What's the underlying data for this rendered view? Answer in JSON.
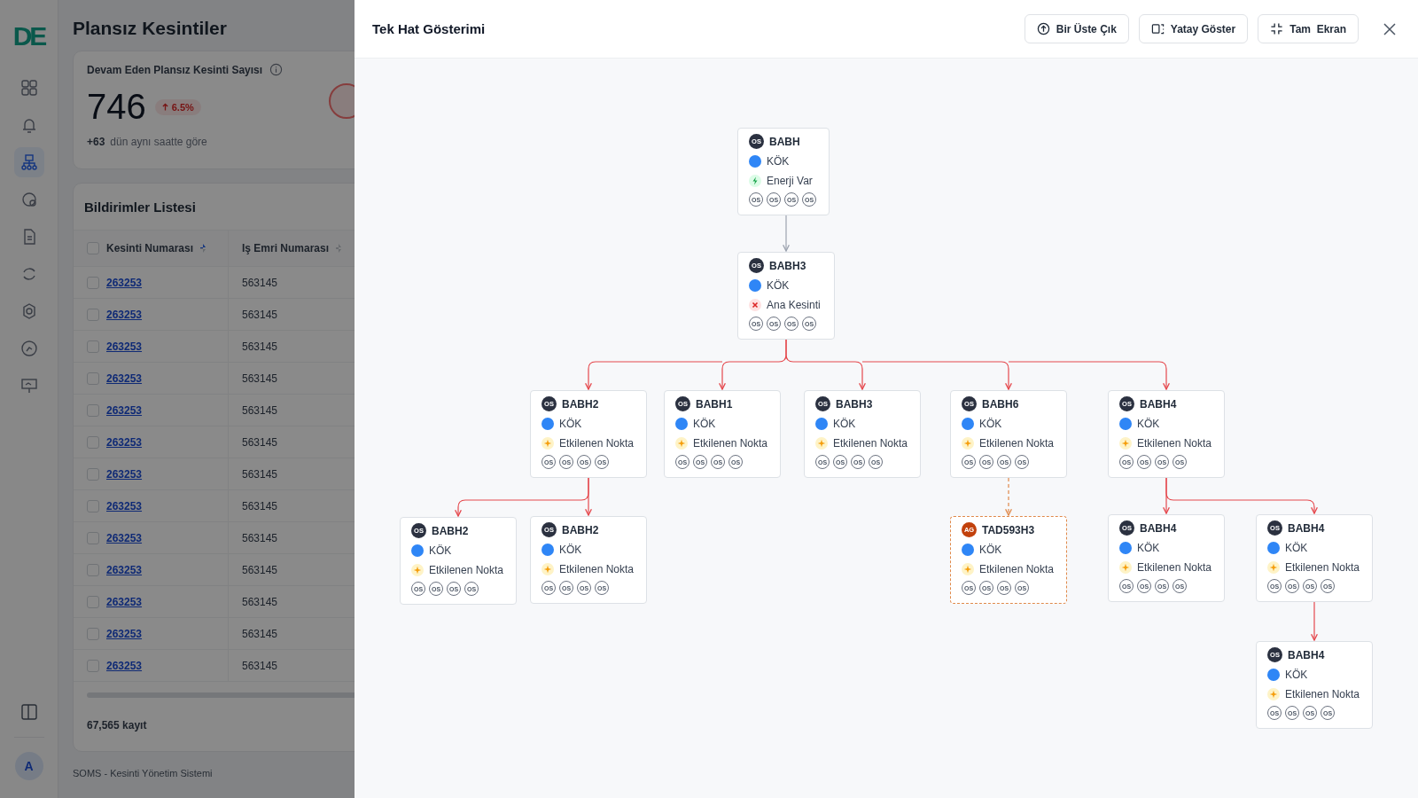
{
  "app": {
    "logo_text": "DE",
    "title": "Plansız Kesintiler",
    "sidebar": {
      "items": [
        {
          "selected": false
        },
        {
          "selected": false
        },
        {
          "selected": true
        },
        {
          "selected": false
        },
        {
          "selected": false
        },
        {
          "selected": false
        },
        {
          "selected": false
        },
        {
          "selected": false
        },
        {
          "selected": false
        }
      ],
      "avatar": "A"
    },
    "summary": {
      "label": "Devam Eden Plansız Kesinti Sayısı",
      "value": "746",
      "change": "6.5%",
      "delta": "+63",
      "delta_note": "dün aynı saatte göre"
    },
    "list": {
      "title": "Bildirimler Listesi",
      "header_checked": false,
      "columns": [
        "Kesinti Numarası",
        "Iş Emri Numarası"
      ],
      "rows": [
        {
          "checked": false,
          "cells": [
            "263253",
            "563145"
          ]
        },
        {
          "checked": false,
          "cells": [
            "263253",
            "563145"
          ]
        },
        {
          "checked": false,
          "cells": [
            "263253",
            "563145"
          ]
        },
        {
          "checked": false,
          "cells": [
            "263253",
            "563145"
          ]
        },
        {
          "checked": false,
          "cells": [
            "263253",
            "563145"
          ]
        },
        {
          "checked": false,
          "cells": [
            "263253",
            "563145"
          ]
        },
        {
          "checked": false,
          "cells": [
            "263253",
            "563145"
          ]
        },
        {
          "checked": false,
          "cells": [
            "263253",
            "563145"
          ]
        },
        {
          "checked": false,
          "cells": [
            "263253",
            "563145"
          ]
        },
        {
          "checked": false,
          "cells": [
            "263253",
            "563145"
          ]
        },
        {
          "checked": false,
          "cells": [
            "263253",
            "563145"
          ]
        },
        {
          "checked": false,
          "cells": [
            "263253",
            "563145"
          ]
        },
        {
          "checked": false,
          "cells": [
            "263253",
            "563145"
          ]
        }
      ],
      "count": "67,565 kayıt"
    },
    "footer": "SOMS - Kesinti Yönetim Sistemi"
  },
  "modal": {
    "title": "Tek Hat Gösterimi",
    "buttons": [
      {
        "kind": "up",
        "label": "Bir Üste Çık"
      },
      {
        "kind": "horizontal",
        "label": "Yatay Göster"
      },
      {
        "kind": "fullscreen",
        "label": "Tam  Ekran"
      }
    ],
    "root": {
      "name": "BABH",
      "badge": "OS",
      "color": "#2b3140",
      "type": "KÖK",
      "status": {
        "kind": "energized",
        "label": "Enerji Var"
      },
      "tags": [
        "OS",
        "OS",
        "OS",
        "OS"
      ],
      "dashed": false,
      "children": [
        {
          "name": "BABH3",
          "badge": "OS",
          "color": "#2b3140",
          "type": "KÖK",
          "status": {
            "kind": "main_outage",
            "label": "Ana Kesinti"
          },
          "tags": [
            "OS",
            "OS",
            "OS",
            "OS"
          ],
          "dashed": false,
          "children": [
            {
              "name": "BABH2",
              "badge": "OS",
              "color": "#2b3140",
              "type": "KÖK",
              "status": {
                "kind": "affected",
                "label": "Etkilenen Nokta"
              },
              "tags": [
                "OS",
                "OS",
                "OS",
                "OS"
              ],
              "dashed": false,
              "children": [
                {
                  "name": "BABH2",
                  "badge": "OS",
                  "color": "#2b3140",
                  "type": "KÖK",
                  "status": {
                    "kind": "affected",
                    "label": "Etkilenen Nokta"
                  },
                  "tags": [
                    "OS",
                    "OS",
                    "OS",
                    "OS"
                  ],
                  "dashed": false
                },
                {
                  "name": "BABH2",
                  "badge": "OS",
                  "color": "#2b3140",
                  "type": "KÖK",
                  "status": {
                    "kind": "affected",
                    "label": "Etkilenen Nokta"
                  },
                  "tags": [
                    "OS",
                    "OS",
                    "OS",
                    "OS"
                  ],
                  "dashed": false
                }
              ]
            },
            {
              "name": "BABH1",
              "badge": "OS",
              "color": "#2b3140",
              "type": "KÖK",
              "status": {
                "kind": "affected",
                "label": "Etkilenen Nokta"
              },
              "tags": [
                "OS",
                "OS",
                "OS",
                "OS"
              ],
              "dashed": false
            },
            {
              "name": "BABH3",
              "badge": "OS",
              "color": "#2b3140",
              "type": "KÖK",
              "status": {
                "kind": "affected",
                "label": "Etkilenen Nokta"
              },
              "tags": [
                "OS",
                "OS",
                "OS",
                "OS"
              ],
              "dashed": false
            },
            {
              "name": "BABH6",
              "badge": "OS",
              "color": "#2b3140",
              "type": "KÖK",
              "status": {
                "kind": "affected",
                "label": "Etkilenen Nokta"
              },
              "tags": [
                "OS",
                "OS",
                "OS",
                "OS"
              ],
              "dashed": false,
              "children": [
                {
                  "name": "TAD593H3",
                  "badge": "AG",
                  "color": "#c2410c",
                  "type": "KÖK",
                  "status": {
                    "kind": "affected",
                    "label": "Etkilenen Nokta"
                  },
                  "tags": [
                    "OS",
                    "OS",
                    "OS",
                    "OS"
                  ],
                  "dashed": true
                }
              ]
            },
            {
              "name": "BABH4",
              "badge": "OS",
              "color": "#2b3140",
              "type": "KÖK",
              "status": {
                "kind": "affected",
                "label": "Etkilenen Nokta"
              },
              "tags": [
                "OS",
                "OS",
                "OS",
                "OS"
              ],
              "dashed": false,
              "children": [
                {
                  "name": "BABH4",
                  "badge": "OS",
                  "color": "#2b3140",
                  "type": "KÖK",
                  "status": {
                    "kind": "affected",
                    "label": "Etkilenen Nokta"
                  },
                  "tags": [
                    "OS",
                    "OS",
                    "OS",
                    "OS"
                  ],
                  "dashed": false
                },
                {
                  "name": "BABH4",
                  "badge": "OS",
                  "color": "#2b3140",
                  "type": "KÖK",
                  "status": {
                    "kind": "affected",
                    "label": "Etkilenen Nokta"
                  },
                  "tags": [
                    "OS",
                    "OS",
                    "OS",
                    "OS"
                  ],
                  "dashed": false,
                  "children": [
                    {
                      "name": "BABH4",
                      "badge": "OS",
                      "color": "#2b3140",
                      "type": "KÖK",
                      "status": {
                        "kind": "affected",
                        "label": "Etkilenen Nokta"
                      },
                      "tags": [
                        "OS",
                        "OS",
                        "OS",
                        "OS"
                      ],
                      "dashed": false
                    }
                  ]
                }
              ]
            }
          ]
        }
      ]
    }
  }
}
